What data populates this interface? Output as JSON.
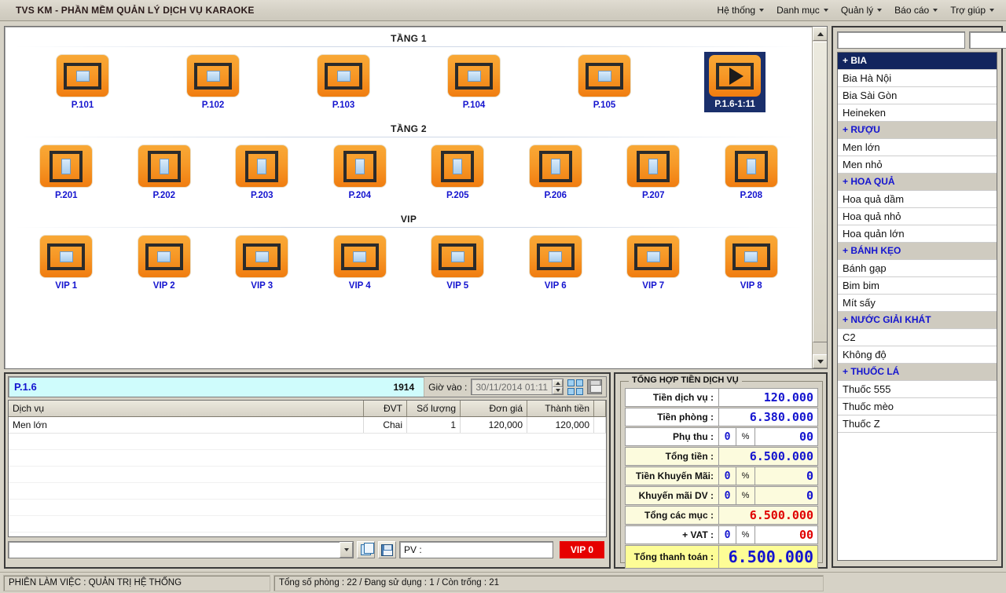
{
  "window": {
    "title": "TVS KM - PHẦN MỀM QUẢN LÝ DỊCH VỤ KARAOKE"
  },
  "menubar": {
    "items": [
      {
        "label": "Hệ thống"
      },
      {
        "label": "Danh mục"
      },
      {
        "label": "Quản lý"
      },
      {
        "label": "Báo cáo"
      },
      {
        "label": "Trợ giúp"
      }
    ]
  },
  "rooms_panel": {
    "floors": [
      {
        "title": "TẦNG 1",
        "shape": "wide",
        "rooms": [
          {
            "label": "P.101",
            "state": "free"
          },
          {
            "label": "P.102",
            "state": "free"
          },
          {
            "label": "P.103",
            "state": "free"
          },
          {
            "label": "P.104",
            "state": "free"
          },
          {
            "label": "P.105",
            "state": "free"
          },
          {
            "label": "P.1.6-1:11",
            "state": "occupied",
            "selected": true
          }
        ]
      },
      {
        "title": "TẦNG 2",
        "shape": "tall",
        "rooms": [
          {
            "label": "P.201",
            "state": "free"
          },
          {
            "label": "P.202",
            "state": "free"
          },
          {
            "label": "P.203",
            "state": "free"
          },
          {
            "label": "P.204",
            "state": "free"
          },
          {
            "label": "P.205",
            "state": "free"
          },
          {
            "label": "P.206",
            "state": "free"
          },
          {
            "label": "P.207",
            "state": "free"
          },
          {
            "label": "P.208",
            "state": "free"
          }
        ]
      },
      {
        "title": "VIP",
        "shape": "wide",
        "rooms": [
          {
            "label": "VIP 1",
            "state": "free"
          },
          {
            "label": "VIP 2",
            "state": "free"
          },
          {
            "label": "VIP 3",
            "state": "free"
          },
          {
            "label": "VIP 4",
            "state": "free"
          },
          {
            "label": "VIP 5",
            "state": "free"
          },
          {
            "label": "VIP 6",
            "state": "free"
          },
          {
            "label": "VIP 7",
            "state": "free"
          },
          {
            "label": "VIP 8",
            "state": "free"
          }
        ]
      }
    ]
  },
  "catalog": {
    "search_value": "",
    "search_placeholder": "",
    "search_code_value": "",
    "items": [
      {
        "label": "+ BIA",
        "type": "group",
        "selected": true
      },
      {
        "label": "Bia Hà Nội",
        "type": "item"
      },
      {
        "label": "Bia Sài Gòn",
        "type": "item"
      },
      {
        "label": "Heineken",
        "type": "item"
      },
      {
        "label": "+ RƯỢU",
        "type": "group"
      },
      {
        "label": "Men lớn",
        "type": "item"
      },
      {
        "label": "Men nhỏ",
        "type": "item"
      },
      {
        "label": "+ HOA QUẢ",
        "type": "group"
      },
      {
        "label": "Hoa quả dầm",
        "type": "item"
      },
      {
        "label": "Hoa quả nhỏ",
        "type": "item"
      },
      {
        "label": "Hoa quản lớn",
        "type": "item"
      },
      {
        "label": "+ BÁNH KẸO",
        "type": "group"
      },
      {
        "label": "Bánh gạp",
        "type": "item"
      },
      {
        "label": "Bim bim",
        "type": "item"
      },
      {
        "label": "Mít sấy",
        "type": "item"
      },
      {
        "label": "+ NƯỚC GIẢI KHÁT",
        "type": "group"
      },
      {
        "label": "C2",
        "type": "item"
      },
      {
        "label": "Không độ",
        "type": "item"
      },
      {
        "label": "+ THUỐC LÁ",
        "type": "group"
      },
      {
        "label": "Thuốc 555",
        "type": "item"
      },
      {
        "label": "Thuốc mèo",
        "type": "item"
      },
      {
        "label": "Thuốc Z",
        "type": "item"
      }
    ]
  },
  "invoice": {
    "room_name": "P.1.6",
    "room_code": "1914",
    "checkin_label": "Giờ vào :",
    "checkin_value": "30/11/2014 01:11",
    "columns": {
      "service": "Dịch vụ",
      "unit": "ĐVT",
      "qty": "Số lượng",
      "price": "Đơn giá",
      "amount": "Thành tiền"
    },
    "rows": [
      {
        "service": "Men lớn",
        "unit": "Chai",
        "qty": "1",
        "price": "120,000",
        "amount": "120,000"
      }
    ],
    "toolbar": {
      "combo_value": "",
      "pv_label": "PV :",
      "vip_badge": "VIP  0"
    }
  },
  "totals": {
    "title": "TỔNG HỢP TIỀN DỊCH VỤ",
    "rows": [
      {
        "label": "Tiền dịch vụ :",
        "value": "120.000",
        "has_pct": false,
        "style": "plain",
        "color": "blue"
      },
      {
        "label": "Tiền phòng :",
        "value": "6.380.000",
        "has_pct": false,
        "style": "plain",
        "color": "blue"
      },
      {
        "label": "Phụ thu :",
        "pct": "0",
        "pct_sign": "%",
        "value": "00",
        "has_pct": true,
        "style": "plain",
        "color": "blue"
      },
      {
        "label": "Tổng tiền :",
        "value": "6.500.000",
        "has_pct": false,
        "style": "highlight",
        "color": "blue"
      },
      {
        "label": "Tiền Khuyến Mãi:",
        "pct": "0",
        "pct_sign": "%",
        "value": "0",
        "has_pct": true,
        "style": "highlight",
        "color": "blue"
      },
      {
        "label": "Khuyến mãi DV :",
        "pct": "0",
        "pct_sign": "%",
        "value": "0",
        "has_pct": true,
        "style": "highlight",
        "color": "blue"
      },
      {
        "label": "Tổng các mục :",
        "value": "6.500.000",
        "has_pct": false,
        "style": "highlight",
        "color": "red"
      },
      {
        "label": "+ VAT :",
        "pct": "0",
        "pct_sign": "%",
        "value": "00",
        "has_pct": true,
        "style": "plain",
        "color": "red"
      },
      {
        "label": "Tổng thanh toán :",
        "value": "6.500.000",
        "has_pct": false,
        "style": "grand",
        "color": "blue"
      }
    ]
  },
  "statusbar": {
    "session": "PHIÊN LÀM VIỆC : QUẢN TRỊ HỆ THỐNG",
    "rooms": "Tổng số phòng : 22 / Đang sử dụng : 1 / Còn trống : 21"
  },
  "colors": {
    "accent_blue": "#1414cf",
    "selection_navy": "#12255e",
    "room_orange": "#f79a28",
    "alert_red": "#e60000",
    "grand_yellow": "#fdfd96"
  }
}
